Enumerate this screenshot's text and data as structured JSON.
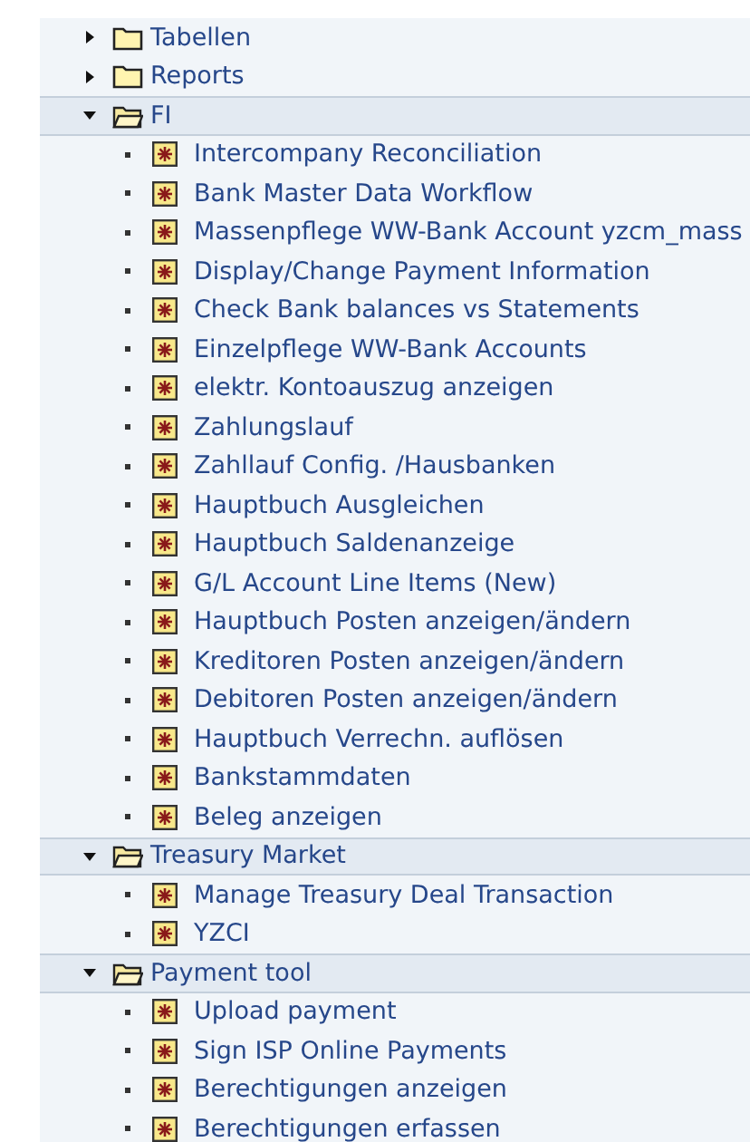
{
  "tree": [
    {
      "kind": "folder",
      "label": "Tabellen",
      "expanded": false
    },
    {
      "kind": "folder",
      "label": "Reports",
      "expanded": false
    },
    {
      "kind": "folder",
      "label": "FI",
      "expanded": true,
      "children": [
        {
          "kind": "transaction",
          "label": "Intercompany Reconciliation"
        },
        {
          "kind": "transaction",
          "label": "Bank Master Data Workflow"
        },
        {
          "kind": "transaction",
          "label": "Massenpflege WW-Bank Account yzcm_mass"
        },
        {
          "kind": "transaction",
          "label": "Display/Change Payment Information"
        },
        {
          "kind": "transaction",
          "label": "Check Bank balances vs Statements"
        },
        {
          "kind": "transaction",
          "label": "Einzelpflege WW-Bank Accounts"
        },
        {
          "kind": "transaction",
          "label": "elektr. Kontoauszug anzeigen"
        },
        {
          "kind": "transaction",
          "label": "Zahlungslauf"
        },
        {
          "kind": "transaction",
          "label": "Zahllauf Config. /Hausbanken"
        },
        {
          "kind": "transaction",
          "label": "Hauptbuch Ausgleichen"
        },
        {
          "kind": "transaction",
          "label": "Hauptbuch Saldenanzeige"
        },
        {
          "kind": "transaction",
          "label": "G/L Account Line Items (New)"
        },
        {
          "kind": "transaction",
          "label": "Hauptbuch Posten anzeigen/ändern"
        },
        {
          "kind": "transaction",
          "label": "Kreditoren Posten anzeigen/ändern"
        },
        {
          "kind": "transaction",
          "label": "Debitoren Posten anzeigen/ändern"
        },
        {
          "kind": "transaction",
          "label": "Hauptbuch Verrechn. auflösen"
        },
        {
          "kind": "transaction",
          "label": "Bankstammdaten"
        },
        {
          "kind": "transaction",
          "label": "Beleg anzeigen"
        }
      ]
    },
    {
      "kind": "folder",
      "label": "Treasury Market",
      "expanded": true,
      "children": [
        {
          "kind": "transaction",
          "label": "Manage Treasury Deal Transaction"
        },
        {
          "kind": "transaction",
          "label": "YZCI"
        }
      ]
    },
    {
      "kind": "folder",
      "label": "Payment tool",
      "expanded": true,
      "children": [
        {
          "kind": "transaction",
          "label": "Upload payment"
        },
        {
          "kind": "transaction",
          "label": "Sign ISP Online Payments"
        },
        {
          "kind": "transaction",
          "label": "Berechtigungen anzeigen"
        },
        {
          "kind": "transaction",
          "label": "Berechtigungen erfassen"
        }
      ]
    }
  ]
}
